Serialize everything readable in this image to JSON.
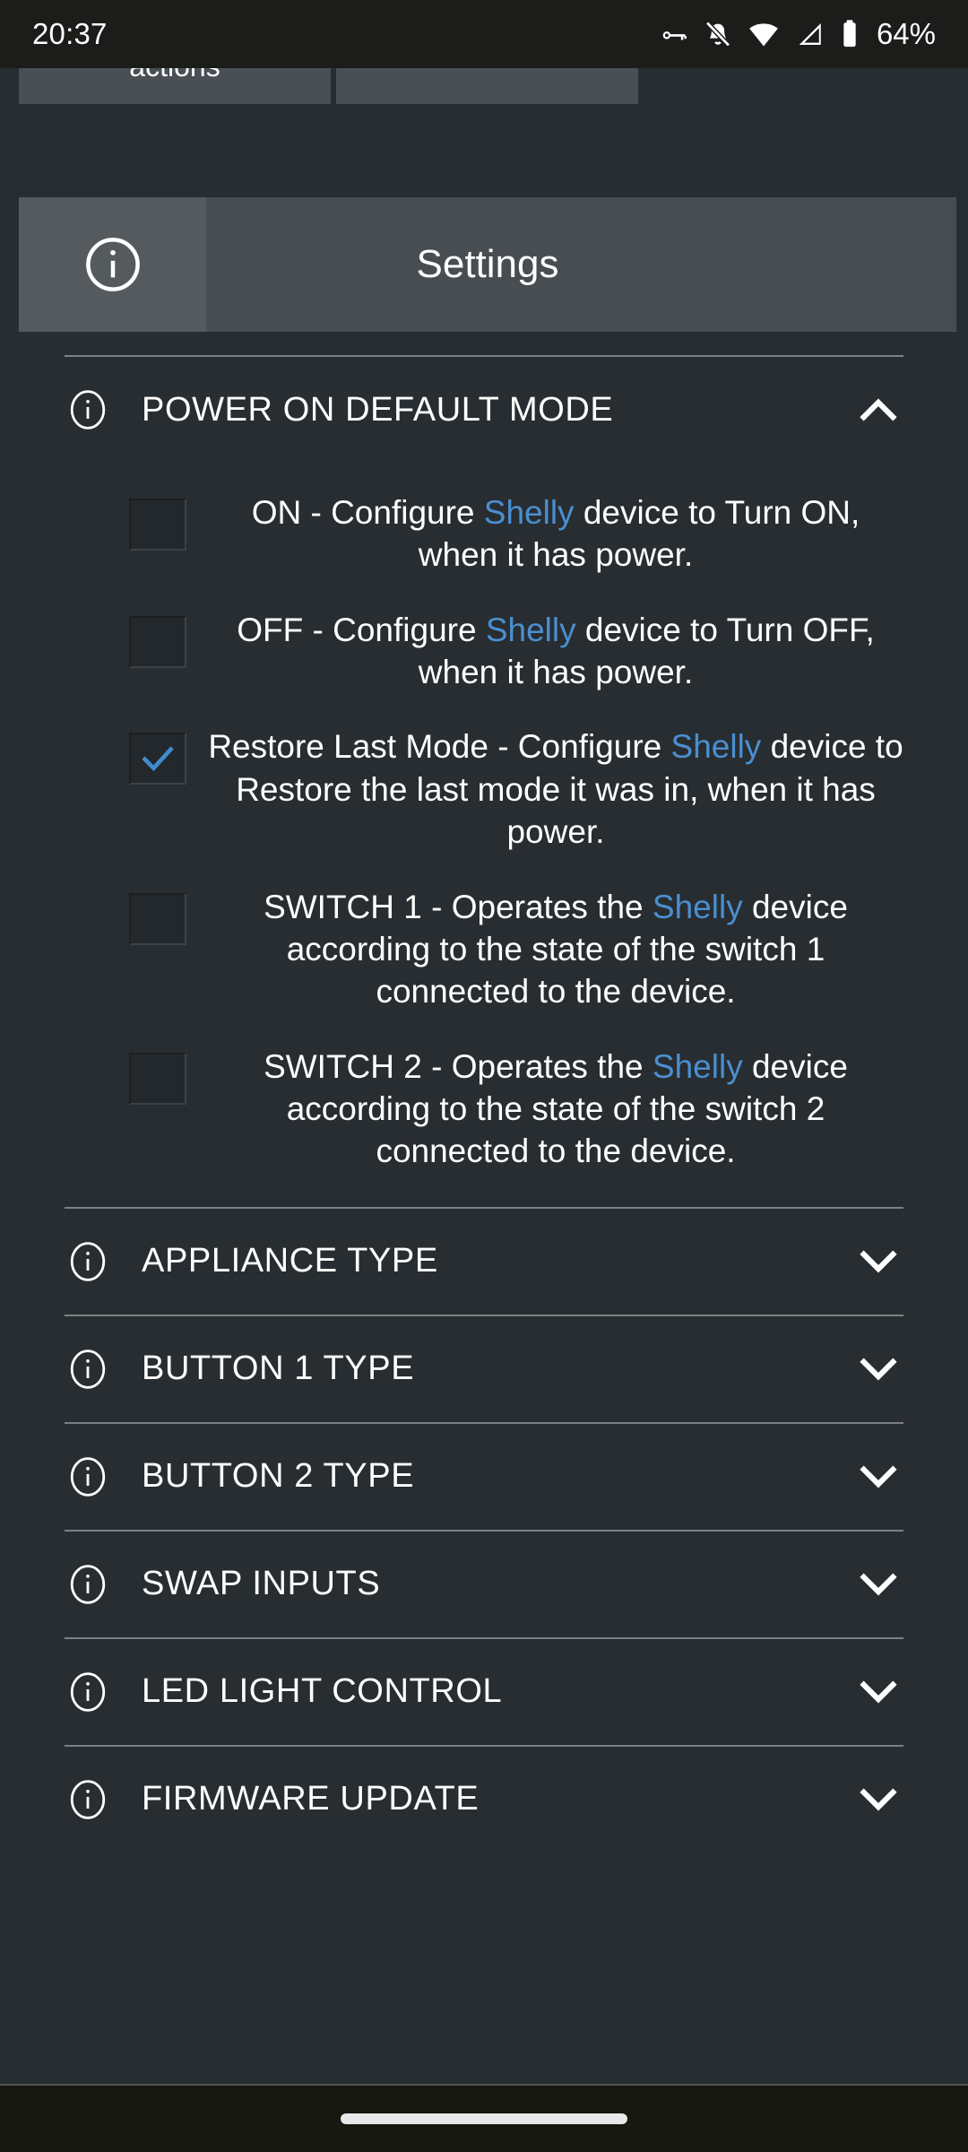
{
  "status_bar": {
    "time": "20:37",
    "battery_percent": "64%",
    "icons": [
      "vpn-key-icon",
      "notifications-off-icon",
      "wifi-icon",
      "signal-cellular-icon",
      "battery-icon"
    ]
  },
  "top_partial_row": {
    "left_label": "actions",
    "right_label": ""
  },
  "settings_header": {
    "info_icon": "info-icon",
    "title": "Settings"
  },
  "sections": {
    "power_on_default_mode": {
      "label": "POWER ON DEFAULT MODE",
      "info_icon": "info-icon",
      "expanded": true,
      "chevron": "chevron-up-icon",
      "options": [
        {
          "id": "on",
          "checked": false,
          "prefix": "ON - Configure ",
          "brand": "Shelly",
          "suffix": " device to Turn ON, when it has power."
        },
        {
          "id": "off",
          "checked": false,
          "prefix": "OFF - Configure ",
          "brand": "Shelly",
          "suffix": " device to Turn OFF, when it has power."
        },
        {
          "id": "restore-last-mode",
          "checked": true,
          "prefix": "Restore Last Mode - Configure ",
          "brand": "Shelly",
          "suffix": " device to Restore the last mode it was in, when it has power."
        },
        {
          "id": "switch-1",
          "checked": false,
          "prefix": "SWITCH 1 - Operates the ",
          "brand": "Shelly",
          "suffix": " device according to the state of the switch 1 connected to the device."
        },
        {
          "id": "switch-2",
          "checked": false,
          "prefix": "SWITCH 2 - Operates the ",
          "brand": "Shelly",
          "suffix": " device according to the state of the switch 2 connected to the device."
        }
      ]
    },
    "collapsed": [
      {
        "id": "appliance-type",
        "label": "APPLIANCE TYPE",
        "info_icon": "info-icon",
        "chevron": "chevron-down-icon"
      },
      {
        "id": "button-1-type",
        "label": "BUTTON 1 TYPE",
        "info_icon": "info-icon",
        "chevron": "chevron-down-icon"
      },
      {
        "id": "button-2-type",
        "label": "BUTTON 2 TYPE",
        "info_icon": "info-icon",
        "chevron": "chevron-down-icon"
      },
      {
        "id": "swap-inputs",
        "label": "SWAP INPUTS",
        "info_icon": "info-icon",
        "chevron": "chevron-down-icon"
      },
      {
        "id": "led-light-control",
        "label": "LED LIGHT CONTROL",
        "info_icon": "info-icon",
        "chevron": "chevron-down-icon"
      },
      {
        "id": "firmware-update",
        "label": "FIRMWARE UPDATE",
        "info_icon": "info-icon",
        "chevron": "chevron-down-icon"
      }
    ]
  },
  "colors": {
    "background": "#282d31",
    "brand_blue": "#4a8fd0",
    "header_bar": "#474d51",
    "divider": "#7b8184",
    "status_bar": "#1c1d1a"
  },
  "nav_bar": {
    "handle": "gesture-home-handle"
  }
}
